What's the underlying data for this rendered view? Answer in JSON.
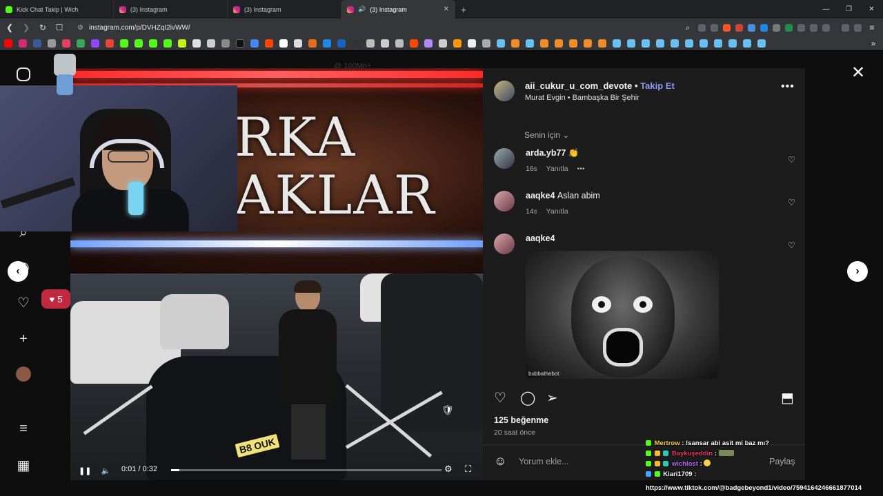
{
  "browser": {
    "tabs": [
      {
        "label": "Kick Chat Takip | Wich",
        "favicon": "kick-icon",
        "active": false
      },
      {
        "label": "(3) Instagram",
        "favicon": "instagram-icon",
        "active": false
      },
      {
        "label": "(3) Instagram",
        "favicon": "instagram-icon",
        "active": false
      },
      {
        "label": "(3) Instagram",
        "favicon": "instagram-icon",
        "active": true
      }
    ],
    "new_tab_icon": "+",
    "window_controls": [
      "—",
      "❐",
      "✕"
    ],
    "url": "instagram.com/p/DVHZqI2ivWW/"
  },
  "sidebar": {
    "likes_badge_count": "5",
    "icons": [
      "instagram-logo-icon",
      "search-icon",
      "explore-icon",
      "heart-icon",
      "plus-icon",
      "profile-avatar",
      "menu-icon",
      "grid-icon"
    ]
  },
  "post": {
    "faint_caption": "@ 100Mn+",
    "video_title_line1": "RKA",
    "video_title_line2": "AKLAR",
    "license_plate": "B8 OUK",
    "video_time": "0:01 / 0:32",
    "video_progress": 0.03,
    "author": {
      "username": "aii_cukur_u_com_devote",
      "separator": "•",
      "follow_label": "Takip Et",
      "audio_line": "Murat Evgin • Bambaşka Bir Şehir",
      "more_label": "•••"
    },
    "sort_label": "Senin için ⌄",
    "comments": [
      {
        "username": "arda.yb77",
        "text": "👏",
        "time": "16s",
        "reply": "Yanıtla",
        "more": "•••"
      },
      {
        "username": "aaqke4",
        "text": "Aslan abim",
        "time": "14s",
        "reply": "Yanıtla"
      },
      {
        "username": "aaqke4",
        "text": "",
        "gif_watermark": "bubbathebot"
      }
    ],
    "likes_label": "125 beğenme",
    "time_ago": "20 saat önce",
    "comment_placeholder": "Yorum ekle...",
    "share_label": "Paylaş"
  },
  "stream_chat": [
    {
      "user": "Mertrow",
      "user_color": "#f2d14b",
      "message": ": !sansar abi asit mi baz mı?"
    },
    {
      "user": "Baykuşeddin",
      "user_color": "#e83a6c",
      "message": ":"
    },
    {
      "user": "wichlost",
      "user_color": "#b66cff",
      "message": ":"
    },
    {
      "user": "Kiari1709",
      "user_color": "#ffffff",
      "message": ":"
    }
  ],
  "stream_chat_link": "https://www.tiktok.com/@badgebeyond1/video/7594164246661877014"
}
